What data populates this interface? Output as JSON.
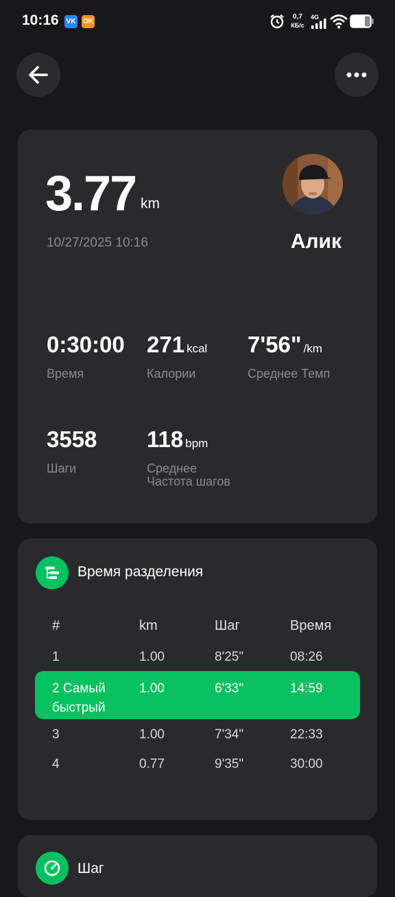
{
  "status_bar": {
    "time": "10:16",
    "vk_badge": "VK",
    "ok_badge": "OK",
    "speed_value": "0,7",
    "speed_unit": "КБ/с",
    "network": "4G"
  },
  "summary": {
    "distance": "3.77",
    "distance_unit": "km",
    "datetime": "10/27/2025 10:16",
    "user_name": "Алик",
    "stats": [
      {
        "value": "0:30:00",
        "unit": "",
        "label": "Время"
      },
      {
        "value": "271",
        "unit": "kcal",
        "label": "Калории"
      },
      {
        "value": "7'56\"",
        "unit": "/km",
        "label": "Среднее Темп"
      },
      {
        "value": "3558",
        "unit": "",
        "label": "Шаги"
      },
      {
        "value": "118",
        "unit": "bpm",
        "label": "Среднее\nЧастота шагов"
      }
    ]
  },
  "splits": {
    "title": "Время разделения",
    "headers": [
      "#",
      "km",
      "Шаг",
      "Время"
    ],
    "rows": [
      {
        "num": "1",
        "km": "1.00",
        "pace": "8'25\"",
        "time": "08:26",
        "fastest": false
      },
      {
        "num": "2  Самый быстрый",
        "km": "1.00",
        "pace": "6'33\"",
        "time": "14:59",
        "fastest": true
      },
      {
        "num": "3",
        "km": "1.00",
        "pace": "7'34\"",
        "time": "22:33",
        "fastest": false
      },
      {
        "num": "4",
        "km": "0.77",
        "pace": "9'35\"",
        "time": "30:00",
        "fastest": false
      }
    ]
  },
  "pace_section": {
    "title": "Шаг"
  },
  "colors": {
    "accent": "#07c160",
    "background": "#18181a",
    "card": "#2a2a2d"
  }
}
